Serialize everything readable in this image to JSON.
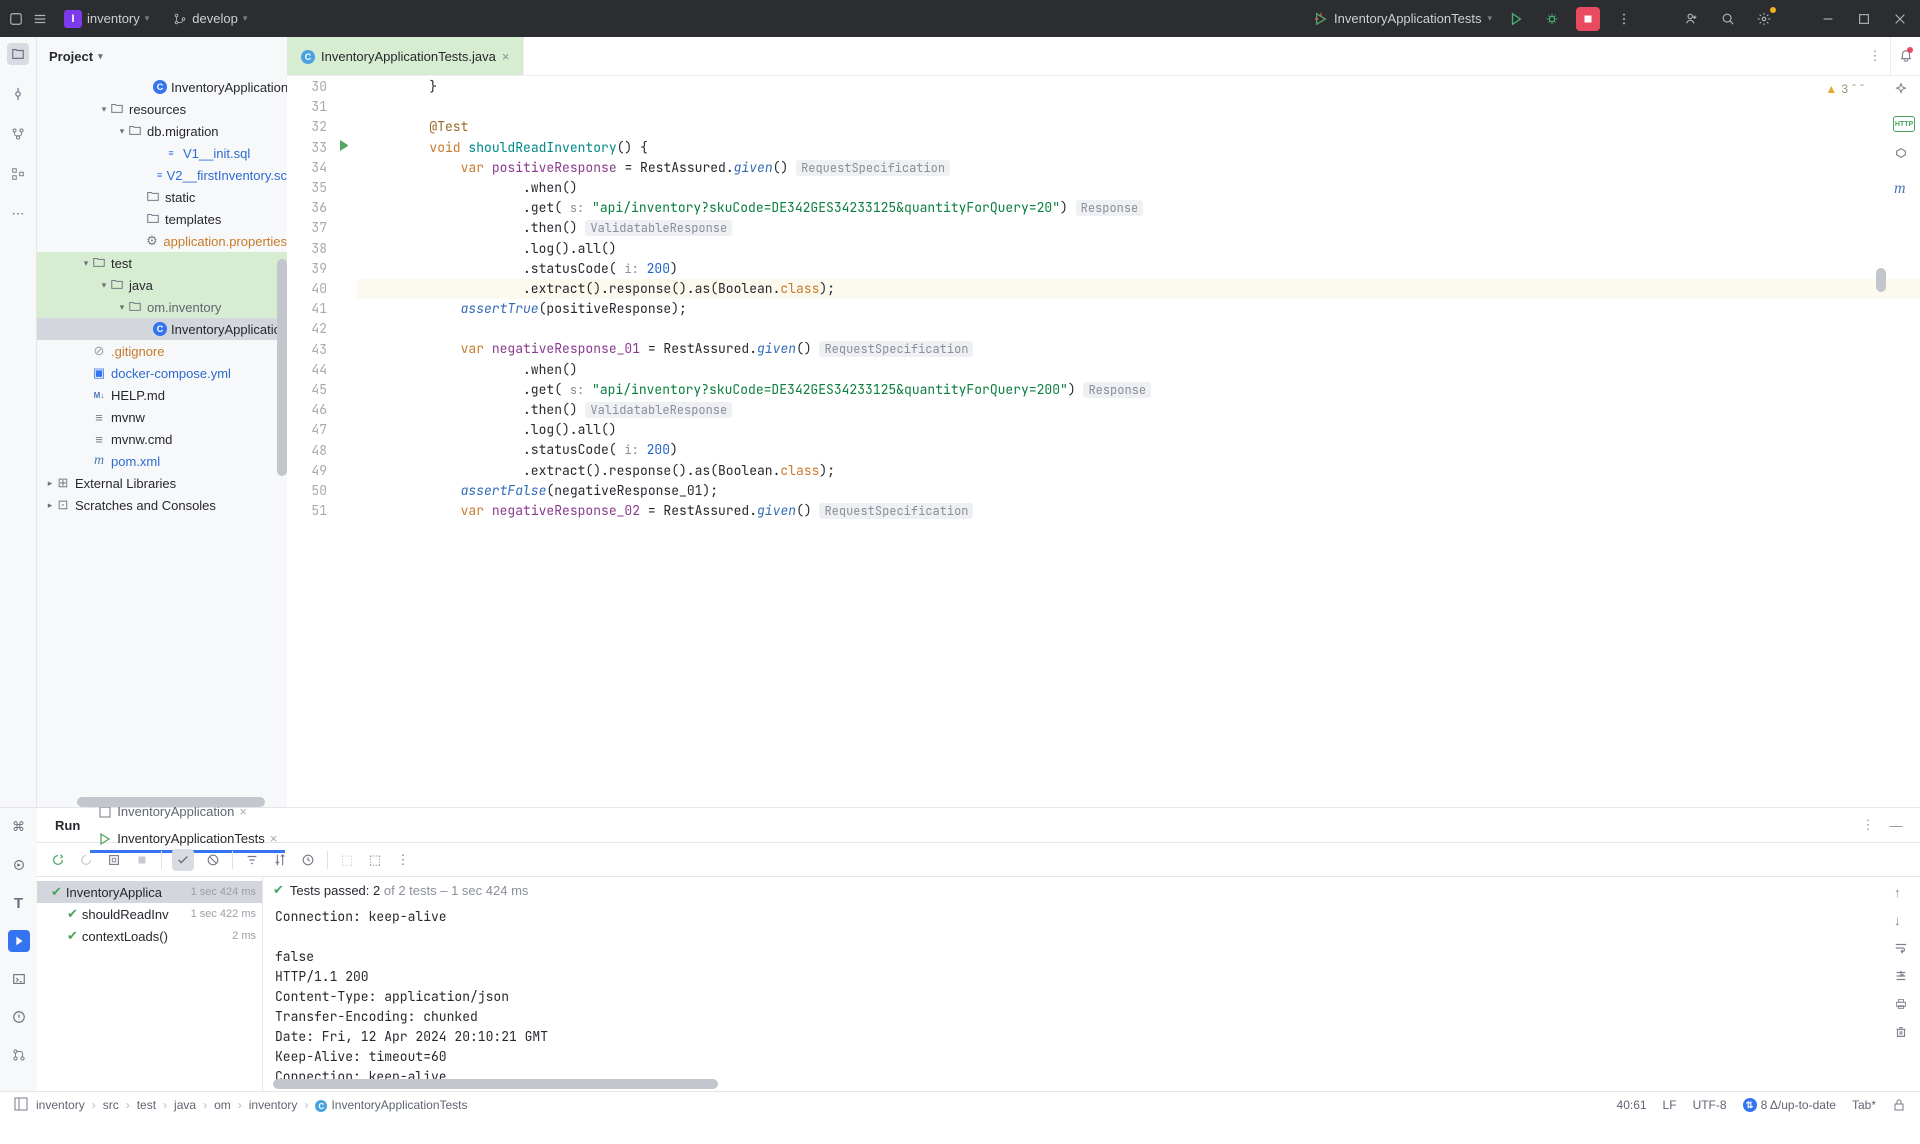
{
  "topBar": {
    "projectName": "inventory",
    "branch": "develop",
    "runConfig": "InventoryApplicationTests"
  },
  "projectPanel": {
    "title": "Project",
    "items": [
      {
        "indent": 116,
        "arrow": "",
        "icon": "C",
        "iconColor": "#3574f0",
        "text": "InventoryApplication",
        "cls": ""
      },
      {
        "indent": 62,
        "arrow": "v",
        "icon": "folder",
        "text": "resources",
        "cls": ""
      },
      {
        "indent": 80,
        "arrow": "v",
        "icon": "folder",
        "text": "db.migration",
        "cls": ""
      },
      {
        "indent": 116,
        "arrow": "",
        "icon": "sql",
        "text": "V1__init.sql",
        "cls": "blue"
      },
      {
        "indent": 116,
        "arrow": "",
        "icon": "sql",
        "text": "V2__firstInventory.sc",
        "cls": "blue"
      },
      {
        "indent": 98,
        "arrow": "",
        "icon": "folder",
        "text": "static",
        "cls": ""
      },
      {
        "indent": 98,
        "arrow": "",
        "icon": "folder",
        "text": "templates",
        "cls": ""
      },
      {
        "indent": 98,
        "arrow": "",
        "icon": "gear",
        "text": "application.properties",
        "cls": "orange"
      },
      {
        "indent": 44,
        "arrow": "v",
        "icon": "folder",
        "text": "test",
        "cls": "",
        "hl": "green"
      },
      {
        "indent": 62,
        "arrow": "v",
        "icon": "folder",
        "text": "java",
        "cls": "",
        "hl": "green"
      },
      {
        "indent": 80,
        "arrow": "v",
        "icon": "folder",
        "text": "om.inventory",
        "cls": "gray",
        "hl": "green"
      },
      {
        "indent": 116,
        "arrow": "",
        "icon": "C",
        "iconColor": "#3574f0",
        "text": "InventoryApplication",
        "cls": "",
        "sel": true
      },
      {
        "indent": 44,
        "arrow": "",
        "icon": "ignore",
        "text": ".gitignore",
        "cls": "orange"
      },
      {
        "indent": 44,
        "arrow": "",
        "icon": "docker",
        "text": "docker-compose.yml",
        "cls": "blue"
      },
      {
        "indent": 44,
        "arrow": "",
        "icon": "md",
        "text": "HELP.md",
        "cls": ""
      },
      {
        "indent": 44,
        "arrow": "",
        "icon": "file",
        "text": "mvnw",
        "cls": ""
      },
      {
        "indent": 44,
        "arrow": "",
        "icon": "file",
        "text": "mvnw.cmd",
        "cls": ""
      },
      {
        "indent": 44,
        "arrow": "",
        "icon": "m",
        "text": "pom.xml",
        "cls": "blue"
      },
      {
        "indent": 8,
        "arrow": ">",
        "icon": "lib",
        "text": "External Libraries",
        "cls": ""
      },
      {
        "indent": 8,
        "arrow": ">",
        "icon": "scratch",
        "text": "Scratches and Consoles",
        "cls": ""
      }
    ]
  },
  "editor": {
    "fileName": "InventoryApplicationTests.java",
    "warnCount": "3",
    "startLine": 30,
    "gutterMarks": {
      "33": "run"
    },
    "lines": [
      {
        "n": 30,
        "html": "        }"
      },
      {
        "n": 31,
        "html": ""
      },
      {
        "n": 32,
        "html": "        <span class='nm-gold'>@Test</span>"
      },
      {
        "n": 33,
        "html": "        <span class='kw-orange'>void</span> <span class='fn-teal'>shouldReadInventory</span>() {"
      },
      {
        "n": 34,
        "html": "            <span class='kw-orange'>var</span> <span class='cls-purple'>positiveResponse</span> = RestAssured.<span class='kw-blue'>given</span>() <span class='inlay'>RequestSpecification</span>"
      },
      {
        "n": 35,
        "html": "                    .when()"
      },
      {
        "n": 36,
        "html": "                    .get( <span class='inlay-short'>s:</span> <span class='str-green'>\"api/inventory?skuCode=DE342GES34233125&quantityForQuery=20\"</span>) <span class='inlay'>Response</span>"
      },
      {
        "n": 37,
        "html": "                    .then() <span class='inlay'>ValidatableResponse</span>"
      },
      {
        "n": 38,
        "html": "                    .log().all()"
      },
      {
        "n": 39,
        "html": "                    .statusCode( <span class='inlay-short'>i:</span> <span class='num-blue'>200</span>)"
      },
      {
        "n": 40,
        "html": "                    .extract().response().as(Boolean.<span class='kw-orange'>class</span>);",
        "current": true
      },
      {
        "n": 41,
        "html": "            <span class='kw-blue'>assertTrue</span>(positiveResponse);"
      },
      {
        "n": 42,
        "html": ""
      },
      {
        "n": 43,
        "html": "            <span class='kw-orange'>var</span> <span class='cls-purple'>negativeResponse_01</span> = RestAssured.<span class='kw-blue'>given</span>() <span class='inlay'>RequestSpecification</span>"
      },
      {
        "n": 44,
        "html": "                    .when()"
      },
      {
        "n": 45,
        "html": "                    .get( <span class='inlay-short'>s:</span> <span class='str-green'>\"api/inventory?skuCode=DE342GES34233125&quantityForQuery=200\"</span>) <span class='inlay'>Response</span>"
      },
      {
        "n": 46,
        "html": "                    .then() <span class='inlay'>ValidatableResponse</span>"
      },
      {
        "n": 47,
        "html": "                    .log().all()"
      },
      {
        "n": 48,
        "html": "                    .statusCode( <span class='inlay-short'>i:</span> <span class='num-blue'>200</span>)"
      },
      {
        "n": 49,
        "html": "                    .extract().response().as(Boolean.<span class='kw-orange'>class</span>);"
      },
      {
        "n": 50,
        "html": "            <span class='kw-blue'>assertFalse</span>(negativeResponse_01);"
      },
      {
        "n": 51,
        "html": "            <span class='kw-orange'>var</span> <span class='cls-purple'>negativeResponse_02</span> = RestAssured.<span class='kw-blue'>given</span>() <span class='inlay'>RequestSpecification</span>"
      }
    ]
  },
  "runPanel": {
    "title": "Run",
    "tabs": [
      {
        "label": "InventoryApplication",
        "active": false
      },
      {
        "label": "InventoryApplicationTests",
        "active": true
      }
    ],
    "summary": {
      "passed": "2",
      "of": "of 2 tests",
      "time": "1 sec 424 ms"
    },
    "testTree": [
      {
        "name": "InventoryApplica",
        "time": "1 sec 424 ms",
        "indent": 6,
        "sel": true
      },
      {
        "name": "shouldReadInv",
        "time": "1 sec 422 ms",
        "indent": 22
      },
      {
        "name": "contextLoads()",
        "time": "2 ms",
        "indent": 22
      }
    ],
    "console": "Connection: keep-alive\n\nfalse\nHTTP/1.1 200\nContent-Type: application/json\nTransfer-Encoding: chunked\nDate: Fri, 12 Apr 2024 20:10:21 GMT\nKeep-Alive: timeout=60\nConnection: keep-alive"
  },
  "breadcrumb": [
    "inventory",
    "src",
    "test",
    "java",
    "om",
    "inventory",
    "InventoryApplicationTests"
  ],
  "statusBar": {
    "pos": "40:61",
    "sep": "LF",
    "enc": "UTF-8",
    "git": "8 Δ/up-to-date",
    "indent": "Tab*"
  }
}
